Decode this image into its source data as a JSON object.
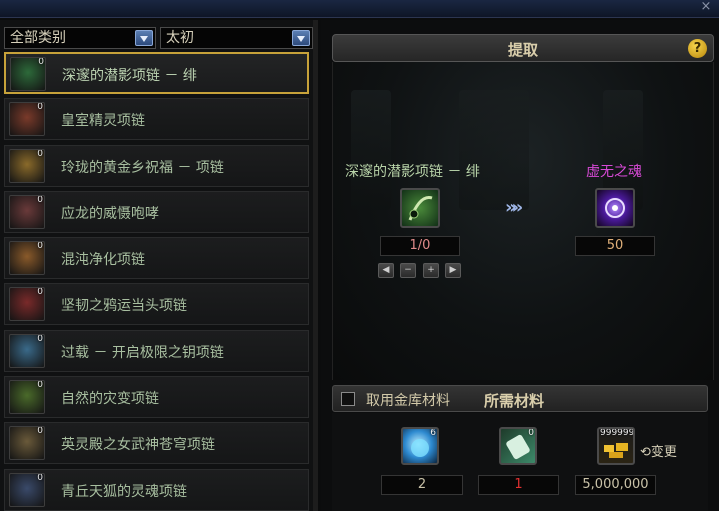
{
  "window": {
    "close_glyph": "×"
  },
  "filters": {
    "category": "全部类别",
    "tier": "太初"
  },
  "list": [
    {
      "label": "深邃的潜影项链 － 绯",
      "count": "0",
      "icon": "dark-necklace-icon",
      "color": "#2d6a3a"
    },
    {
      "label": "皇室精灵项链",
      "count": "0",
      "icon": "fairy-necklace-icon",
      "color": "#7a3a2a"
    },
    {
      "label": "玲珑的黄金乡祝福 － 项链",
      "count": "0",
      "icon": "golden-necklace-icon",
      "color": "#8a6a2a"
    },
    {
      "label": "应龙的威慑咆哮",
      "count": "0",
      "icon": "dragon-roar-icon",
      "color": "#6a3a3a"
    },
    {
      "label": "混沌净化项链",
      "count": "0",
      "icon": "chaos-necklace-icon",
      "color": "#8a5a2a"
    },
    {
      "label": "坚韧之鸦运当头项链",
      "count": "0",
      "icon": "raven-necklace-icon",
      "color": "#7a2a2a"
    },
    {
      "label": "过载 － 开启极限之钥项链",
      "count": "0",
      "icon": "key-necklace-icon",
      "color": "#3a6a8a"
    },
    {
      "label": "自然的灾变项链",
      "count": "0",
      "icon": "nature-necklace-icon",
      "color": "#4a6a2a"
    },
    {
      "label": "英灵殿之女武神苍穹项链",
      "count": "0",
      "icon": "valkyrie-necklace-icon",
      "color": "#6a5a3a"
    },
    {
      "label": "青丘天狐的灵魂项链",
      "count": "0",
      "icon": "fox-soul-necklace-icon",
      "color": "#3a4a6a"
    }
  ],
  "panel": {
    "title": "提取",
    "help": "?",
    "source": {
      "name": "深邃的潜影项链 － 绯",
      "qty": "1/0",
      "icon": "dark-necklace-icon"
    },
    "arrows": "»»",
    "result": {
      "name": "虚无之魂",
      "qty": "50",
      "icon": "void-soul-icon"
    },
    "controls": [
      "◀",
      "−",
      "+",
      "▶"
    ]
  },
  "materials": {
    "use_vault_label": "取用金库材料",
    "required_label": "所需材料",
    "items": [
      {
        "icon": "crystal-orb-icon",
        "badge": "6",
        "value": "2",
        "value_color": "#c9c2a8"
      },
      {
        "icon": "scroll-ticket-icon",
        "badge": "0",
        "value": "1",
        "value_color": "#e03030"
      },
      {
        "icon": "gold-coins-icon",
        "badge": "9999999",
        "value": "5,000,000",
        "value_color": "#c9c2a8"
      }
    ],
    "swap_label": "⟲变更"
  }
}
